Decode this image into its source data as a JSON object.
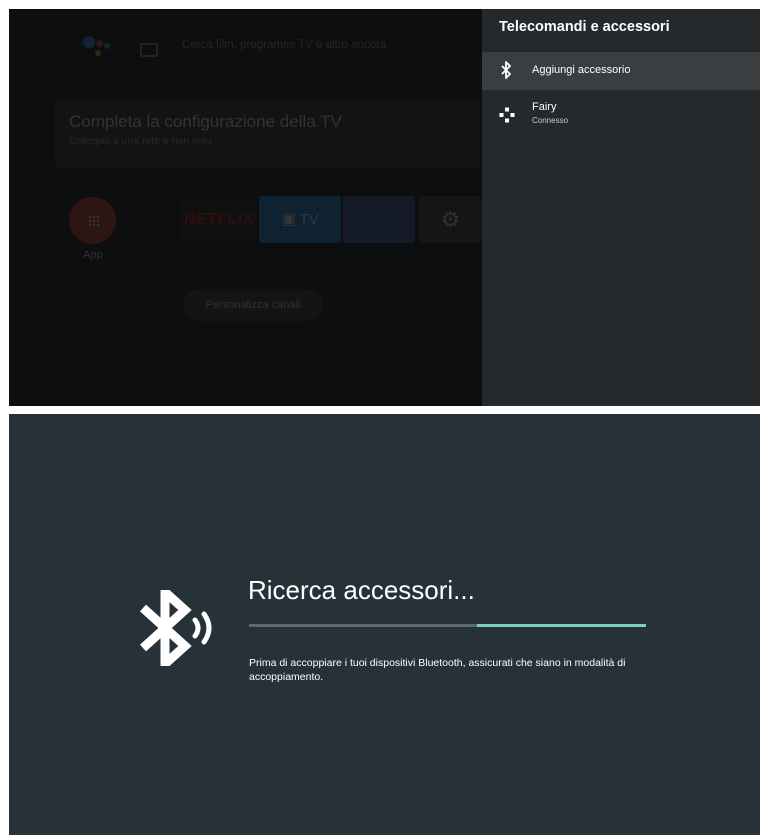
{
  "home": {
    "search_placeholder": "Cerca film, programmi TV e altro ancora",
    "setup_title": "Completa la configurazione della TV",
    "setup_subtitle": "Collegati a una rete e non solo",
    "apps_label": "App",
    "tiles": {
      "netflix": "NETFLIX",
      "tv": "TV"
    },
    "customize_button": "Personalizza canali"
  },
  "panel": {
    "title": "Telecomandi e accessori",
    "items": [
      {
        "label": "Aggiungi accessorio",
        "icon": "bluetooth-icon",
        "selected": true
      },
      {
        "label": "Fairy",
        "status": "Connesso",
        "icon": "gamepad-icon"
      }
    ]
  },
  "pairing": {
    "title": "Ricerca accessori...",
    "description": "Prima di accoppiare i tuoi dispositivi Bluetooth, assicurati che siano in modalità di accoppiamento.",
    "icon": "bluetooth-searching-icon",
    "progress_colors": {
      "track": "#5a6a70",
      "fill": "#80cbc4"
    }
  },
  "colors": {
    "panel_bg": "#26292c",
    "bottom_bg": "#263238"
  }
}
